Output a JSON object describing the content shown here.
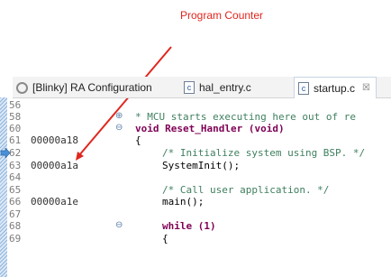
{
  "annotation": {
    "label": "Program Counter"
  },
  "tabs": [
    {
      "label": "[Blinky] RA Configuration",
      "icon": "gear-icon"
    },
    {
      "label": "hal_entry.c",
      "icon": "c-file-icon"
    },
    {
      "label": "startup.c",
      "icon": "c-file-icon",
      "close": "☒"
    }
  ],
  "lines": [
    {
      "num": "56",
      "addr": "",
      "code": ""
    },
    {
      "num": "58",
      "addr": "",
      "code": "* MCU starts executing here out of re",
      "marker": "⊕"
    },
    {
      "num": "60",
      "addr": "",
      "code": "void Reset_Handler (void)",
      "marker": "⊖"
    },
    {
      "num": "61",
      "addr": "00000a18",
      "code": "{"
    },
    {
      "num": "62",
      "addr": "",
      "code": "/* Initialize system using BSP. */"
    },
    {
      "num": "63",
      "addr": "00000a1a",
      "code": "SystemInit();"
    },
    {
      "num": "64",
      "addr": "",
      "code": ""
    },
    {
      "num": "65",
      "addr": "",
      "code": "/* Call user application. */"
    },
    {
      "num": "66",
      "addr": "00000a1e",
      "code": "main();"
    },
    {
      "num": "67",
      "addr": "",
      "code": ""
    },
    {
      "num": "68",
      "addr": "",
      "code": "while (1)",
      "marker": "⊖"
    },
    {
      "num": "69",
      "addr": "",
      "code": "{"
    }
  ],
  "colors": {
    "annotation": "#e0261e",
    "comment": "#3f7f5f",
    "keyword": "#7f0055",
    "pc_marker": "#4a90d9"
  }
}
